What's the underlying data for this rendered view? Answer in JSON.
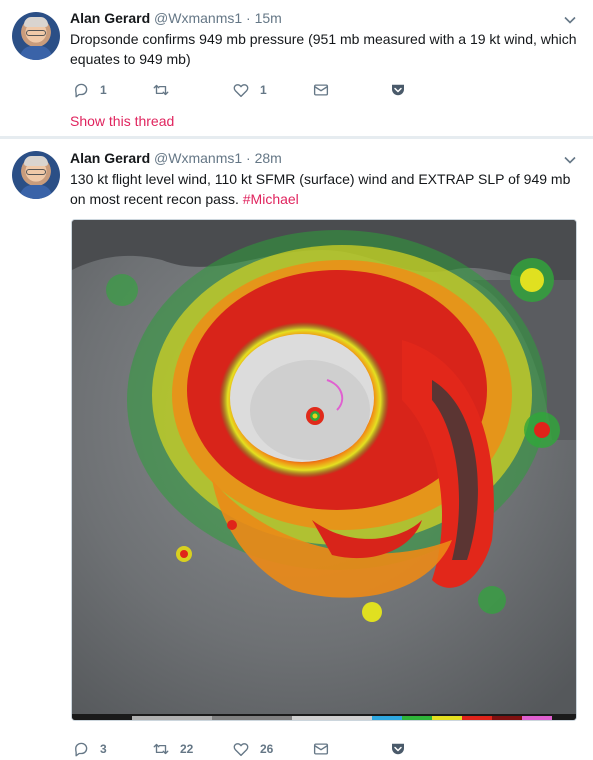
{
  "tweets": [
    {
      "name": "Alan Gerard",
      "handle": "@Wxmanms1",
      "dot": "·",
      "time": "15m",
      "text": "Dropsonde confirms 949 mb pressure (951 mb measured with a 19 kt wind, which equates to 949 mb)",
      "reply_count": "1",
      "retweet_count": "",
      "like_count": "1",
      "show_thread": "Show this thread"
    },
    {
      "name": "Alan Gerard",
      "handle": "@Wxmanms1",
      "dot": "·",
      "time": "28m",
      "text": "130 kt flight level wind, 110 kt SFMR (surface) wind and EXTRAP SLP of 949 mb on most recent recon pass.",
      "hashtag": "#Michael",
      "reply_count": "3",
      "retweet_count": "22",
      "like_count": "26"
    }
  ],
  "colors": {
    "accent": "#e0245e",
    "secondary_text": "#657786",
    "primary_text": "#14171a"
  },
  "icons": [
    "reply-icon",
    "retweet-icon",
    "like-icon",
    "direct-message-icon",
    "pocket-icon",
    "chevron-down-icon"
  ]
}
